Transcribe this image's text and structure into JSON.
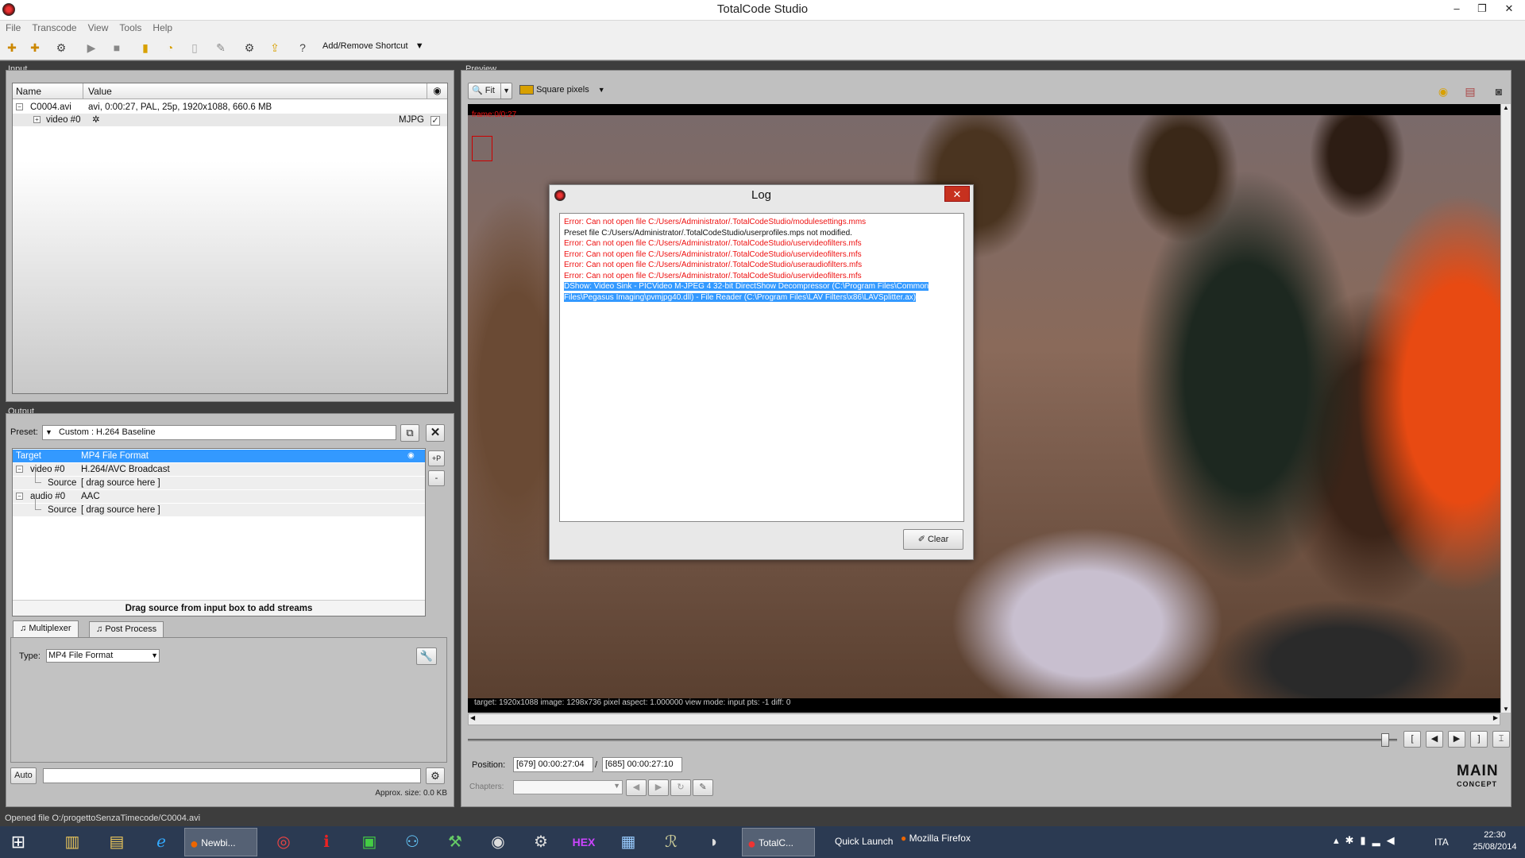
{
  "window": {
    "title": "TotalCode Studio",
    "minimize": "–",
    "restore": "❐",
    "close": "✕"
  },
  "menu": [
    "File",
    "Transcode",
    "View",
    "Tools",
    "Help"
  ],
  "toolbar": {
    "shortcut_label": "Add/Remove Shortcut"
  },
  "input": {
    "label": "Input",
    "col_name": "Name",
    "col_value": "Value",
    "file_name": "C0004.avi",
    "file_value": "avi, 0:00:27, PAL, 25p, 1920x1088, 660.6 MB",
    "stream_name": "video #0",
    "stream_codec": "MJPG"
  },
  "output": {
    "label": "Output",
    "preset_label": "Preset:",
    "preset_value": "Custom : H.264 Baseline",
    "target_label": "Target",
    "target_value": "MP4 File Format",
    "video_name": "video #0",
    "video_value": "H.264/AVC Broadcast",
    "video_source_label": "Source",
    "video_source_value": "[ drag source here ]",
    "audio_name": "audio #0",
    "audio_value": "AAC",
    "audio_source_label": "Source",
    "audio_source_value": "[ drag source here ]",
    "drag_hint": "Drag source from input box to add streams",
    "add_btn": "+P",
    "remove_btn": "-",
    "tab_multiplexer": "Multiplexer",
    "tab_postprocess": "Post Process",
    "type_label": "Type:",
    "type_value": "MP4 File Format",
    "auto_btn": "Auto",
    "approx_size": "Approx. size: 0.0 KB"
  },
  "preview": {
    "label": "Preview",
    "fit": "Fit",
    "square_pixels": "Square pixels",
    "frame_counter": "frame:0/0:27",
    "info": "target: 1920x1088 image: 1298x736 pixel aspect: 1.000000 view mode: input pts: -1 diff: 0",
    "position_label": "Position:",
    "pos_frame1": "[679]",
    "pos_time1": "00:00:27:04",
    "pos_frame2": "[685]",
    "pos_time2": "00:00:27:10",
    "chapters_label": "Chapters:"
  },
  "log": {
    "title": "Log",
    "lines": [
      {
        "type": "err",
        "text": "Error: Can not open file C:/Users/Administrator/.TotalCodeStudio/modulesettings.mms"
      },
      {
        "type": "ok",
        "text": "Preset file C:/Users/Administrator/.TotalCodeStudio/userprofiles.mps not modified."
      },
      {
        "type": "err",
        "text": "Error: Can not open file C:/Users/Administrator/.TotalCodeStudio/uservideofilters.mfs"
      },
      {
        "type": "err",
        "text": "Error: Can not open file C:/Users/Administrator/.TotalCodeStudio/uservideofilters.mfs"
      },
      {
        "type": "err",
        "text": "Error: Can not open file C:/Users/Administrator/.TotalCodeStudio/useraudiofilters.mfs"
      },
      {
        "type": "err",
        "text": "Error: Can not open file C:/Users/Administrator/.TotalCodeStudio/uservideofilters.mfs"
      },
      {
        "type": "hl",
        "text": "DShow: Video Sink - PICVideo M-JPEG 4 32-bit DirectShow Decompressor (C:\\Program Files\\Common Files\\Pegasus Imaging\\pvmjpg40.dll) - File Reader (C:\\Program Files\\LAV Filters\\x86\\LAVSplitter.ax)"
      }
    ],
    "clear_btn": "Clear"
  },
  "logo": {
    "line1": "MAIN",
    "line2": "CONCEPT"
  },
  "status": {
    "text": "Opened file O:/progettoSenzaTimecode/C0004.avi"
  },
  "taskbar": {
    "items": [
      "Newbi...",
      "TotalC..."
    ],
    "quick_launch": "Quick Launch",
    "firefox": "Mozilla Firefox",
    "lang": "ITA",
    "time": "22:30",
    "date": "25/08/2014"
  }
}
